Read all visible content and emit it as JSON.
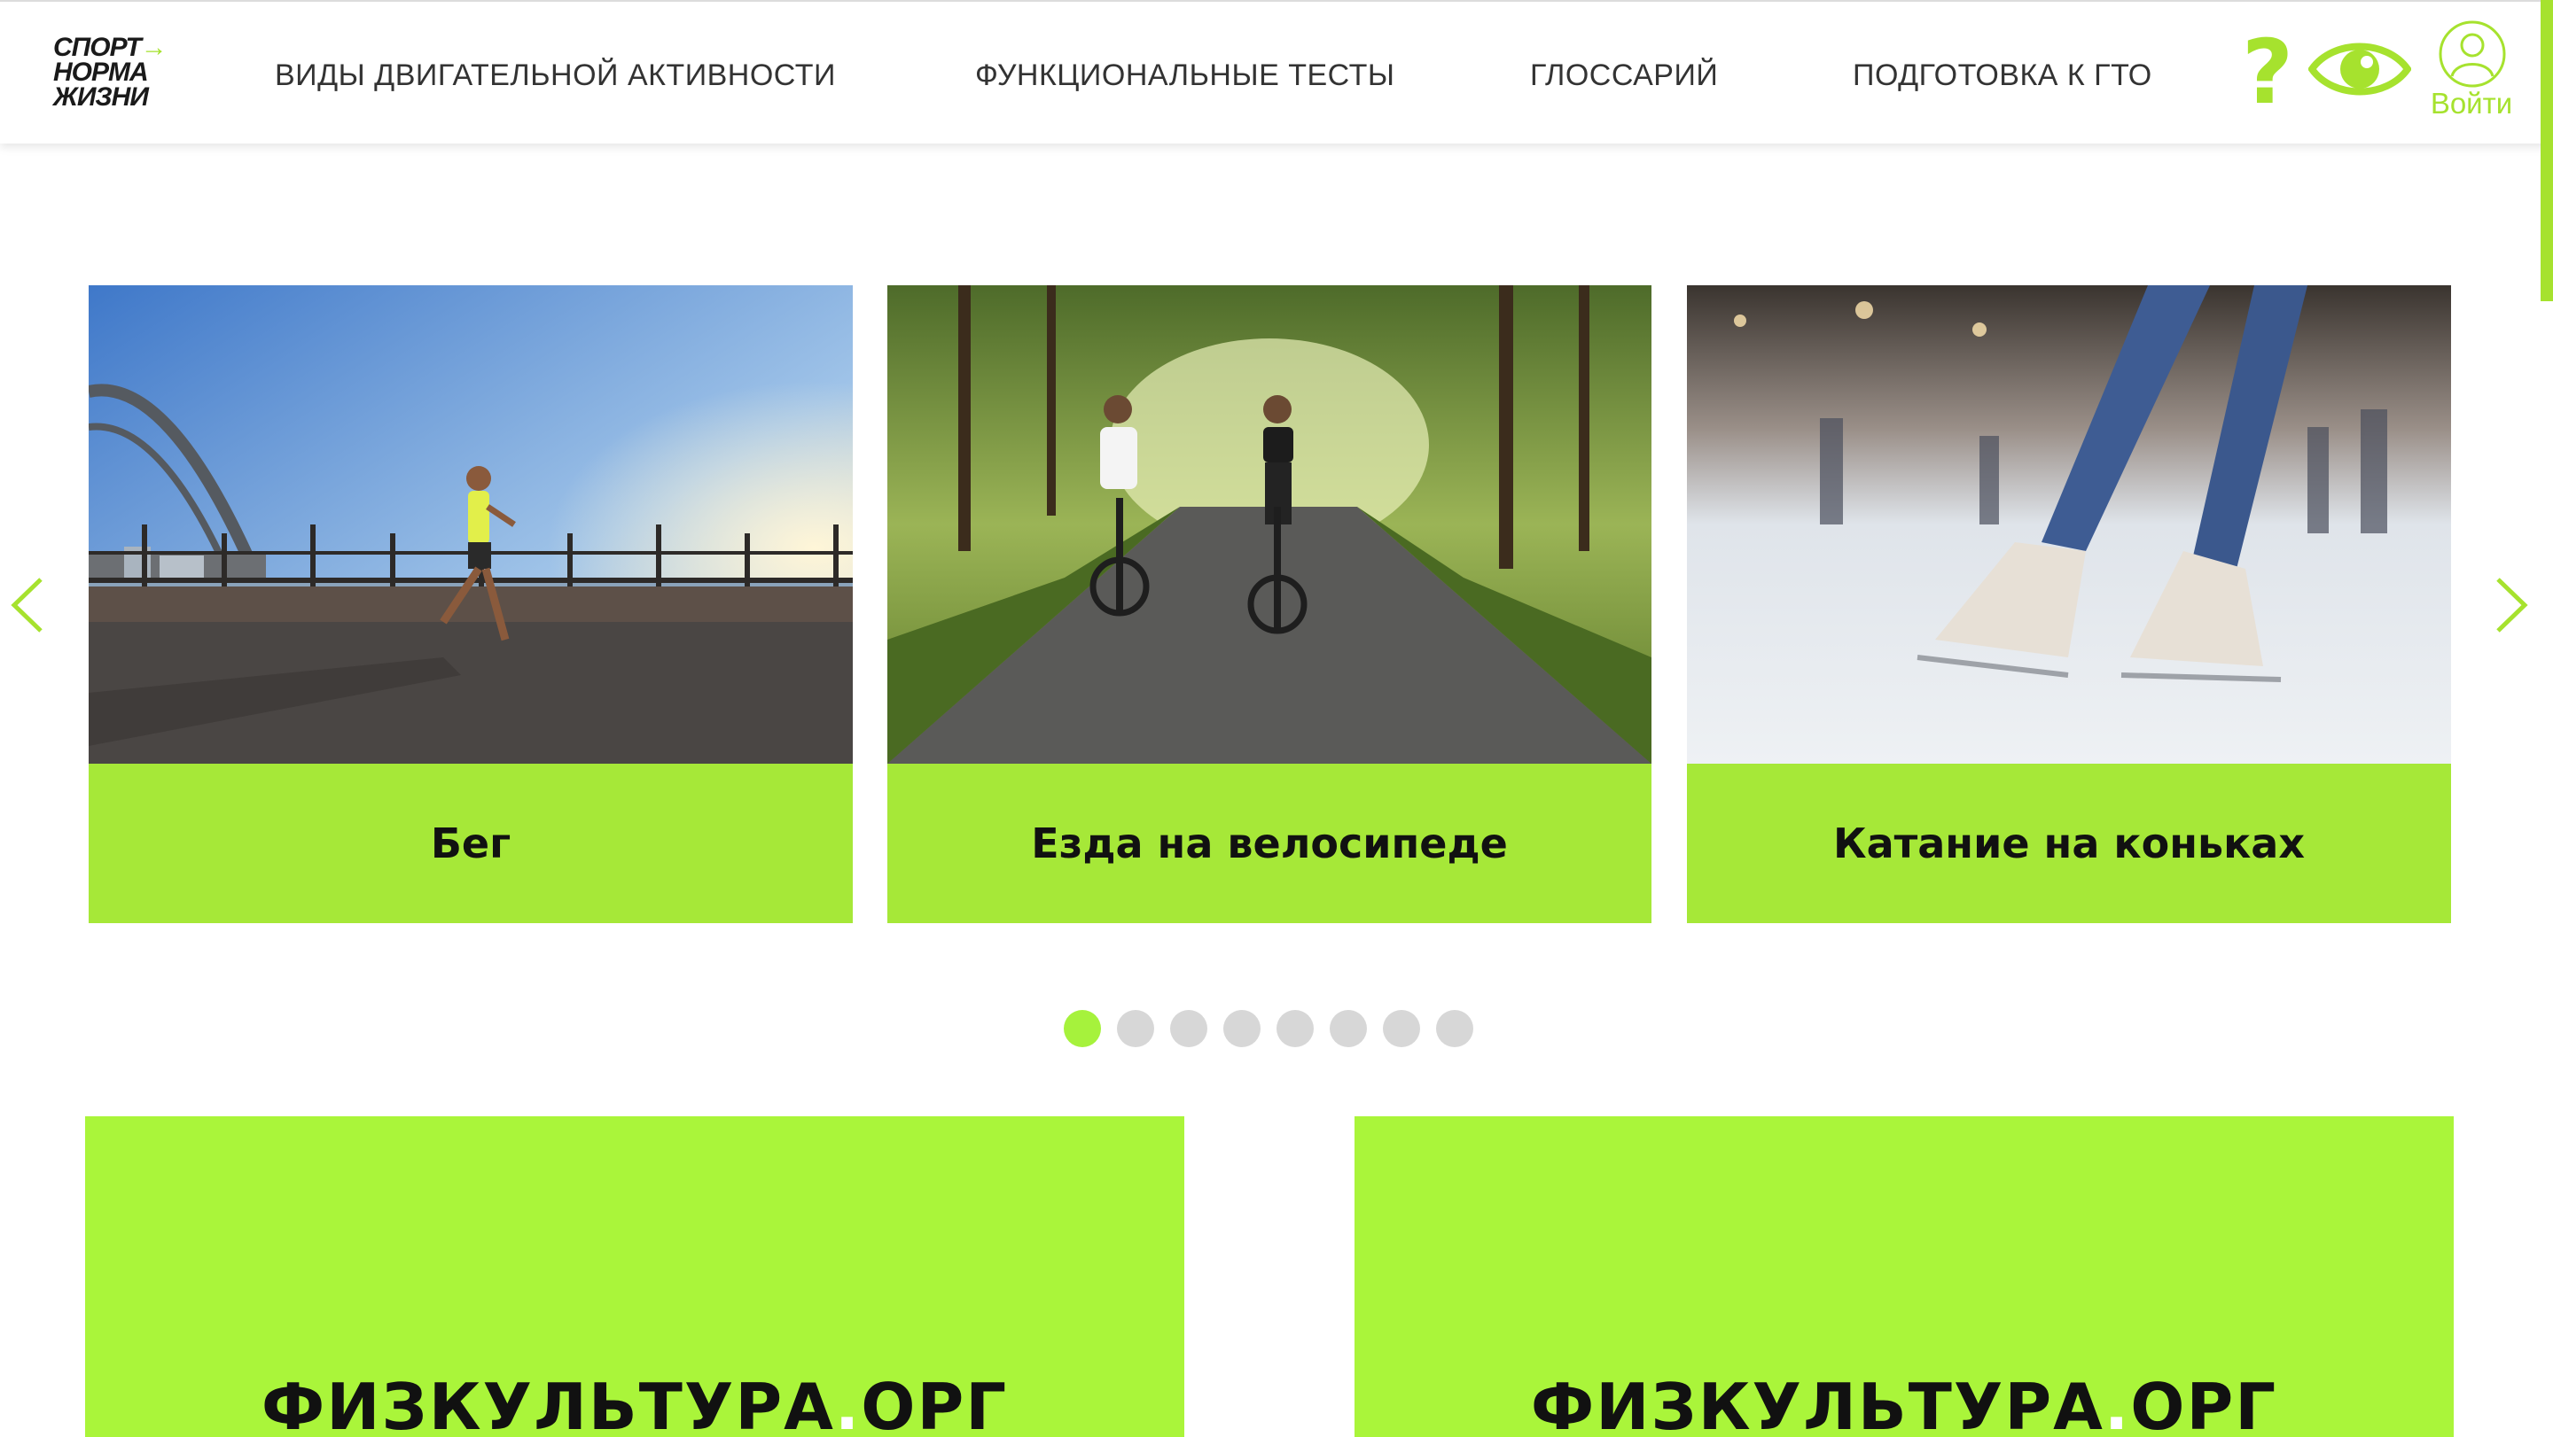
{
  "header": {
    "logo": {
      "line1": "СПОРТ",
      "line2": "НОРМА",
      "line3": "ЖИЗНИ",
      "arrow": "→"
    },
    "nav": [
      {
        "label": "ВИДЫ ДВИГАТЕЛЬНОЙ АКТИВНОСТИ"
      },
      {
        "label": "ФУНКЦИОНАЛЬНЫЕ ТЕСТЫ"
      },
      {
        "label": "ГЛОССАРИЙ"
      },
      {
        "label": "ПОДГОТОВКА К ГТО"
      }
    ],
    "help_icon": "question-mark-icon",
    "help_glyph": "?",
    "eye_icon": "eye-icon",
    "login_label": "Войти",
    "login_icon": "user-icon"
  },
  "carousel": {
    "prev_icon": "chevron-left-icon",
    "next_icon": "chevron-right-icon",
    "cards": [
      {
        "title": "Бег",
        "image": "running-photo"
      },
      {
        "title": "Езда на велосипеде",
        "image": "cycling-photo"
      },
      {
        "title": "Катание на коньках",
        "image": "ice-skating-photo"
      }
    ],
    "dots_total": 8,
    "active_dot": 1
  },
  "banners": [
    {
      "brand": "ФИЗКУЛЬТУРА",
      "sep": ".",
      "suffix": "ОРГ"
    },
    {
      "brand": "ФИЗКУЛЬТУРА",
      "sep": ".",
      "suffix": "ОРГ"
    }
  ],
  "colors": {
    "accent": "#a6e22e",
    "caption_bg": "#a6e838",
    "banner_bg": "#aaf53a",
    "dot_inactive": "#d7d7d7"
  }
}
